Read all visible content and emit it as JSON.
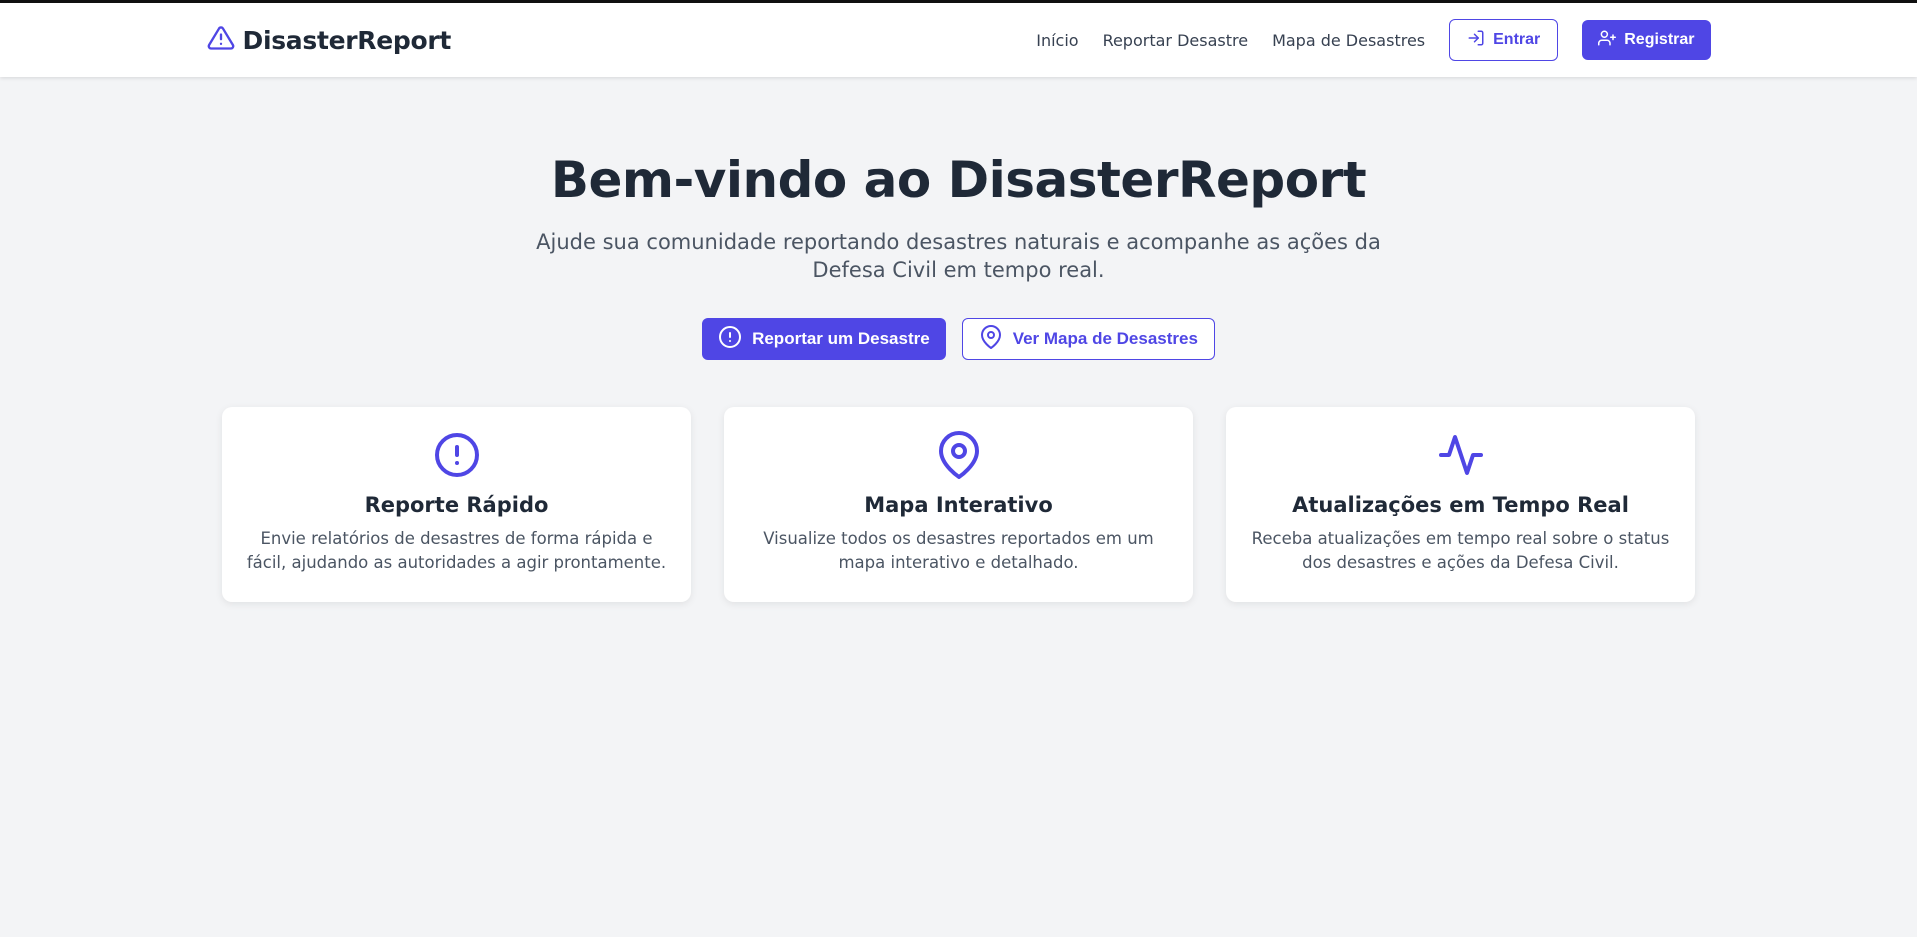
{
  "colors": {
    "accent": "#4f46e5",
    "text_dark": "#1f2937",
    "text_muted": "#4b5563",
    "background": "#f3f4f6"
  },
  "header": {
    "brand": {
      "icon": "warning-triangle-icon",
      "name": "DisasterReport"
    },
    "nav": [
      {
        "label": "Início"
      },
      {
        "label": "Reportar Desastre"
      },
      {
        "label": "Mapa de Desastres"
      }
    ],
    "login": {
      "icon": "login-icon",
      "label": "Entrar"
    },
    "register": {
      "icon": "user-plus-icon",
      "label": "Registrar"
    }
  },
  "hero": {
    "title": "Bem-vindo ao DisasterReport",
    "subtitle": "Ajude sua comunidade reportando desastres naturais e acompanhe as ações da Defesa Civil em tempo real.",
    "primary_action": {
      "icon": "alert-circle-icon",
      "label": "Reportar um Desastre"
    },
    "secondary_action": {
      "icon": "map-pin-icon",
      "label": "Ver Mapa de Desastres"
    }
  },
  "features": [
    {
      "icon": "alert-circle-icon",
      "title": "Reporte Rápido",
      "description": "Envie relatórios de desastres de forma rápida e fácil, ajudando as autoridades a agir prontamente."
    },
    {
      "icon": "map-pin-icon",
      "title": "Mapa Interativo",
      "description": "Visualize todos os desastres reportados em um mapa interativo e detalhado."
    },
    {
      "icon": "activity-icon",
      "title": "Atualizações em Tempo Real",
      "description": "Receba atualizações em tempo real sobre o status dos desastres e ações da Defesa Civil."
    }
  ]
}
